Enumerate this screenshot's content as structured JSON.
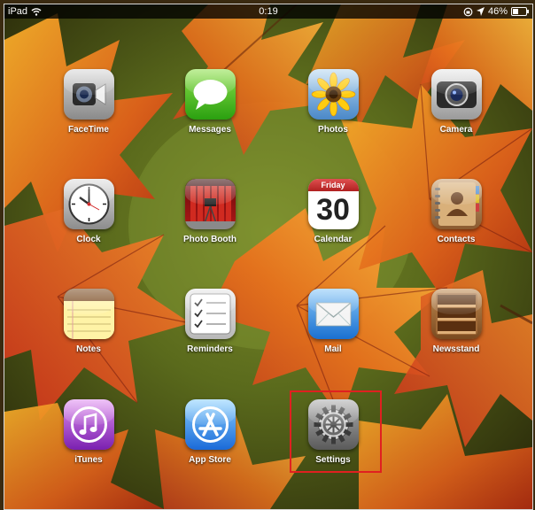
{
  "status_bar": {
    "carrier": "iPad",
    "time": "0:19",
    "battery_percent": "46%",
    "battery_level": 0.46
  },
  "apps": [
    {
      "label": "FaceTime",
      "icon": "facetime-icon"
    },
    {
      "label": "Messages",
      "icon": "messages-icon"
    },
    {
      "label": "Photos",
      "icon": "photos-icon"
    },
    {
      "label": "Camera",
      "icon": "camera-icon"
    },
    {
      "label": "Clock",
      "icon": "clock-icon"
    },
    {
      "label": "Photo Booth",
      "icon": "photo-booth-icon"
    },
    {
      "label": "Calendar",
      "icon": "calendar-icon",
      "calendar_day": "Friday",
      "calendar_date": "30"
    },
    {
      "label": "Contacts",
      "icon": "contacts-icon"
    },
    {
      "label": "Notes",
      "icon": "notes-icon"
    },
    {
      "label": "Reminders",
      "icon": "reminders-icon"
    },
    {
      "label": "Mail",
      "icon": "mail-icon"
    },
    {
      "label": "Newsstand",
      "icon": "newsstand-icon"
    },
    {
      "label": "iTunes",
      "icon": "itunes-icon"
    },
    {
      "label": "App Store",
      "icon": "app-store-icon"
    },
    {
      "label": "Settings",
      "icon": "settings-icon",
      "highlighted": true
    }
  ],
  "colors": {
    "highlight": "#e02020",
    "status_bar": "#000000"
  }
}
